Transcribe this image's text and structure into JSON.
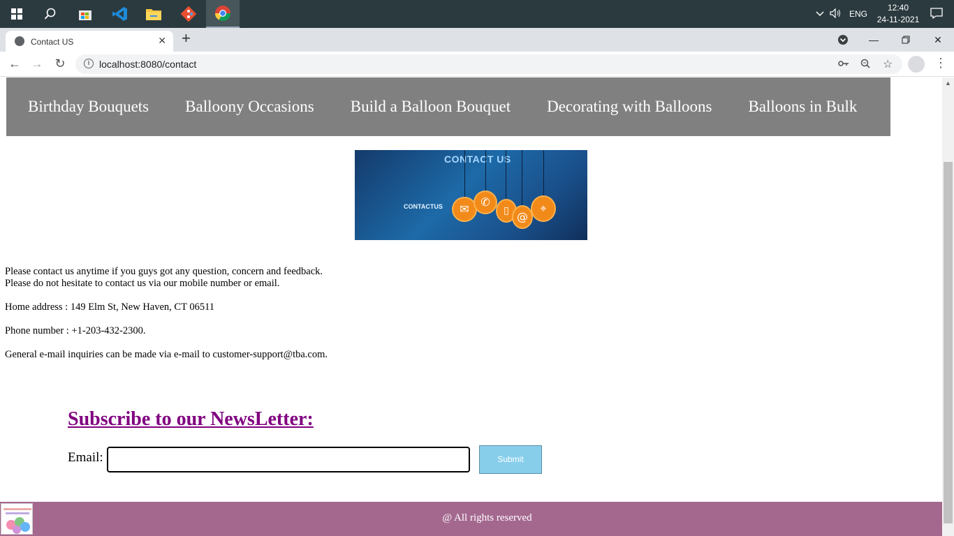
{
  "taskbar": {
    "time": "12:40",
    "date": "24-11-2021",
    "language": "ENG",
    "apps": [
      "windows-start",
      "search",
      "store",
      "vscode",
      "file-explorer",
      "git",
      "chrome"
    ]
  },
  "browser": {
    "tab_title": "Contact US",
    "url": "localhost:8080/contact"
  },
  "nav": {
    "items": [
      "Birthday Bouquets",
      "Balloony Occasions",
      "Build a Balloon Bouquet",
      "Decorating with Balloons",
      "Balloons in Bulk"
    ]
  },
  "banner": {
    "title": "CONTACT US",
    "subtitle": "CONTACTUS"
  },
  "content": {
    "line1": "Please contact us anytime if you guys got any question, concern and feedback.",
    "line2": "Please do not hesitate to contact us via our mobile number or email.",
    "address": "Home address : 149 Elm St, New Haven, CT 06511",
    "phone": "Phone number : +1-203-432-2300.",
    "email": "General e-mail inquiries can be made via e-mail to customer-support@tba.com."
  },
  "newsletter": {
    "title": "Subscribe to our NewsLetter:",
    "email_label": "Email:",
    "email_value": "",
    "submit_label": "Submit"
  },
  "footer": {
    "copyright": "@ All rights reserved"
  },
  "colors": {
    "navbar": "#808080",
    "newsletter_title": "#800080",
    "submit_button": "#87ceeb",
    "footer": "#a4688f"
  }
}
